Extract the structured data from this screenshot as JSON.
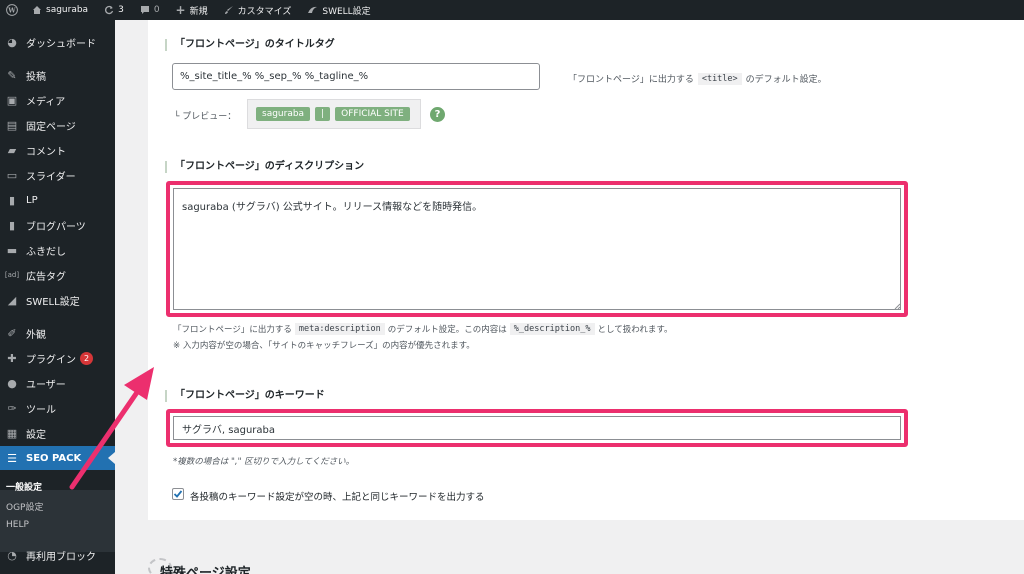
{
  "adminbar": {
    "site_name": "saguraba",
    "updates_count": "3",
    "comments_count": "0",
    "new_label": "新規",
    "customize_label": "カスタマイズ",
    "swell_label": "SWELL設定"
  },
  "sidebar": {
    "items": [
      {
        "label": "ダッシュボード",
        "icon": "dashboard-icon"
      },
      {
        "label": "投稿",
        "icon": "pin-icon"
      },
      {
        "label": "メディア",
        "icon": "media-icon"
      },
      {
        "label": "固定ページ",
        "icon": "page-icon"
      },
      {
        "label": "コメント",
        "icon": "comment-icon"
      },
      {
        "label": "スライダー",
        "icon": "slider-icon"
      },
      {
        "label": "LP",
        "icon": "lp-icon"
      },
      {
        "label": "ブログパーツ",
        "icon": "blogparts-icon"
      },
      {
        "label": "ふきだし",
        "icon": "balloon-icon"
      },
      {
        "label": "広告タグ",
        "icon": "ad-icon",
        "icon_text": "[ad]"
      },
      {
        "label": "SWELL設定",
        "icon": "swell-icon"
      },
      {
        "label": "外観",
        "icon": "appearance-icon"
      },
      {
        "label": "プラグイン",
        "icon": "plugin-icon",
        "badge": "2"
      },
      {
        "label": "ユーザー",
        "icon": "user-icon"
      },
      {
        "label": "ツール",
        "icon": "tool-icon"
      },
      {
        "label": "設定",
        "icon": "settings-icon"
      },
      {
        "label": "SEO PACK",
        "icon": "seopack-icon"
      },
      {
        "label": "再利用ブロック",
        "icon": "reusable-block-icon"
      }
    ],
    "submenu": [
      "一般設定",
      "OGP設定",
      "HELP"
    ]
  },
  "title_section": {
    "heading": "「フロントページ」のタイトルタグ",
    "value": "%_site_title_% %_sep_% %_tagline_%",
    "desc_before": "「フロントページ」に出力する",
    "desc_code": "<title>",
    "desc_after": "のデフォルト設定。",
    "preview_label": "└ プレビュー：",
    "preview_chips": [
      "saguraba",
      "|",
      "OFFICIAL SITE"
    ],
    "help": "?"
  },
  "description_section": {
    "heading": "「フロントページ」のディスクリプション",
    "value": "saguraba (サグラバ) 公式サイト。リリース情報などを随時発信。",
    "note1_before": "「フロントページ」に出力する",
    "note1_code": "meta:description",
    "note1_mid": "のデフォルト設定。この内容は",
    "note1_code2": "%_description_%",
    "note1_after": "として扱われます。",
    "note2": "※ 入力内容が空の場合、「サイトのキャッチフレーズ」の内容が優先されます。"
  },
  "keyword_section": {
    "heading": "「フロントページ」のキーワード",
    "value": "サグラバ, saguraba",
    "note": "*複数の場合は \",\" 区切りで入力してください。",
    "checkbox_label": "各投稿のキーワード設定が空の時、上記と同じキーワードを出力する",
    "checkbox_checked": true
  },
  "next_section": {
    "heading": "特殊ページ設定"
  },
  "colors": {
    "highlight": "#ec2f6e",
    "active_menu": "#2271b1",
    "chip": "#7fb07f"
  }
}
